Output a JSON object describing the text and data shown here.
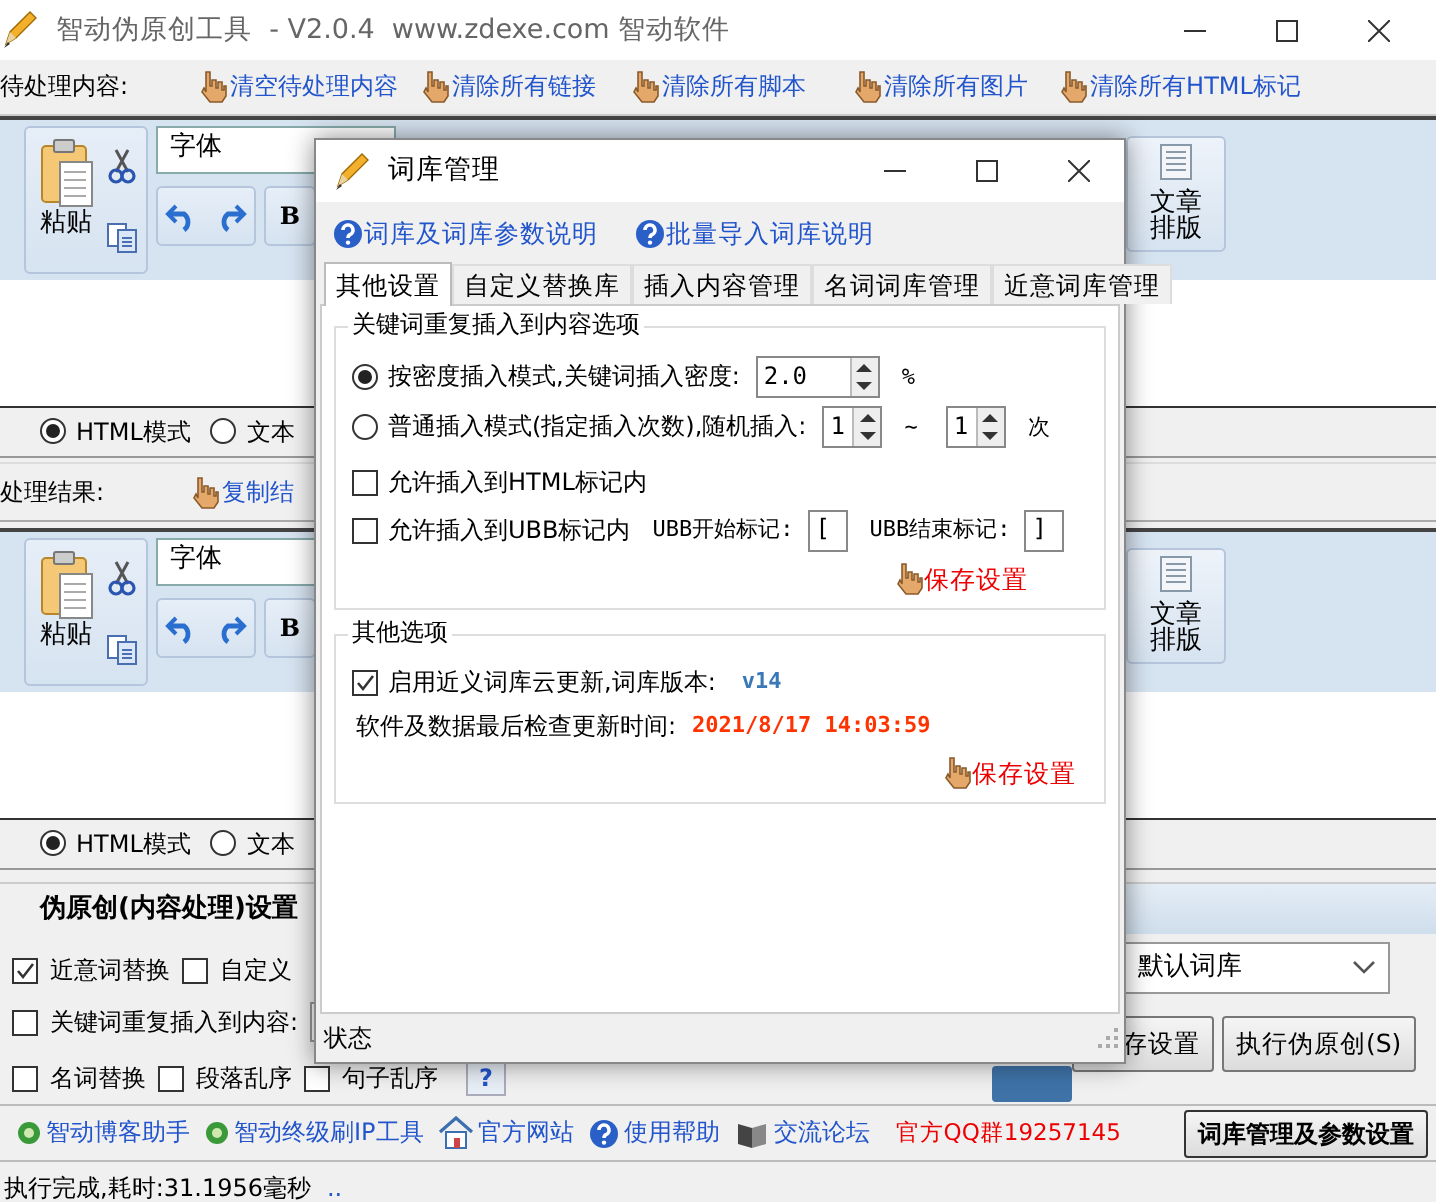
{
  "window": {
    "title": "智动伪原创工具  - V2.0.4  www.zdexe.com 智动软件"
  },
  "input_pane": {
    "label": "待处理内容:",
    "actions": [
      "清空待处理内容",
      "清除所有链接",
      "清除所有脚本",
      "清除所有图片",
      "清除所有HTML标记"
    ],
    "toolbar": {
      "paste": "粘贴",
      "font": "字体",
      "bold": "B",
      "layout": "文章排版"
    },
    "modes": [
      {
        "label": "HTML模式",
        "selected": true
      },
      {
        "label": "文本",
        "selected": false
      }
    ]
  },
  "result_pane": {
    "label": "处理结果:",
    "actions": [
      "复制结"
    ],
    "toolbar": {
      "paste": "粘贴",
      "font": "字体",
      "bold": "B",
      "layout": "文章排版"
    },
    "modes": [
      {
        "label": "HTML模式",
        "selected": true
      },
      {
        "label": "文本",
        "selected": false
      }
    ]
  },
  "settings": {
    "tab": "伪原创(内容处理)设置",
    "rows": [
      [
        {
          "kind": "checkbox",
          "label": "近意词替换",
          "checked": true
        },
        {
          "kind": "checkbox",
          "label": "自定义",
          "checked": false
        }
      ],
      [
        {
          "kind": "checkbox",
          "label": "关键词重复插入到内容:",
          "checked": false
        },
        {
          "kind": "field"
        }
      ],
      [
        {
          "kind": "checkbox",
          "label": "名词替换",
          "checked": false
        },
        {
          "kind": "checkbox",
          "label": "段落乱序",
          "checked": false
        },
        {
          "kind": "checkbox",
          "label": "句子乱序",
          "checked": false
        },
        {
          "kind": "help",
          "text": "?"
        }
      ]
    ],
    "library_select": "默认词库",
    "buttons": [
      "存设置",
      "执行伪原创(S)"
    ]
  },
  "links": [
    {
      "kind": "app",
      "label": "智动博客助手"
    },
    {
      "kind": "app",
      "label": "智动终级刷IP工具"
    },
    {
      "kind": "home",
      "label": "官方网站"
    },
    {
      "kind": "help",
      "label": "使用帮助"
    },
    {
      "kind": "forum",
      "label": "交流论坛"
    },
    {
      "kind": "notice",
      "label": "官方QQ群19257145"
    }
  ],
  "library_button": "词库管理及参数设置",
  "status_bar": {
    "text": "执行完成,耗时:31.1956毫秒",
    "extra": ".."
  },
  "dialog": {
    "title": "词库管理",
    "help_links": [
      "词库及词库参数说明",
      "批量导入词库说明"
    ],
    "tabs": [
      {
        "label": "其他设置",
        "selected": true
      },
      {
        "label": "自定义替换库",
        "selected": false
      },
      {
        "label": "插入内容管理",
        "selected": false
      },
      {
        "label": "名词词库管理",
        "selected": false
      },
      {
        "label": "近意词库管理",
        "selected": false
      }
    ],
    "insert_group": {
      "title": "关键词重复插入到内容选项",
      "radios": [
        {
          "label": "按密度插入模式,关键词插入密度:",
          "selected": true,
          "fields": [
            {
              "kind": "spin",
              "value": "2.0"
            },
            {
              "kind": "text",
              "text": "%"
            }
          ]
        },
        {
          "label": "普通插入模式(指定插入次数),随机插入:",
          "selected": false,
          "fields": [
            {
              "kind": "spin",
              "value": "1"
            },
            {
              "kind": "text",
              "text": "~"
            },
            {
              "kind": "spin",
              "value": "1"
            },
            {
              "kind": "text",
              "text": "次"
            }
          ]
        }
      ],
      "checkboxes": [
        {
          "label": "允许插入到HTML标记内",
          "checked": false
        },
        {
          "label": "允许插入到UBB标记内",
          "checked": false,
          "fields": [
            {
              "kind": "text",
              "text": "UBB开始标记:"
            },
            {
              "kind": "input",
              "value": "["
            },
            {
              "kind": "text",
              "text": "UBB结束标记:"
            },
            {
              "kind": "input",
              "value": "]"
            }
          ]
        }
      ],
      "save": "保存设置"
    },
    "other_group": {
      "title": "其他选项",
      "cloud_update": {
        "label": "启用近义词库云更新,词库版本:",
        "checked": true
      },
      "version": "v14",
      "last_check_label": "软件及数据最后检查更新时间:",
      "last_check": "2021/8/17 14:03:59",
      "save": "保存设置"
    },
    "status": "状态"
  }
}
